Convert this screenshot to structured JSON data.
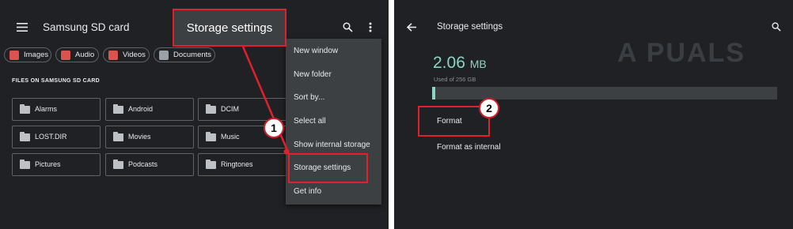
{
  "left_panel": {
    "title": "Samsung SD card",
    "filter_chips": [
      {
        "label": "Images",
        "icon": "image-icon",
        "color": "#d9534f"
      },
      {
        "label": "Audio",
        "icon": "audio-icon",
        "color": "#d9534f"
      },
      {
        "label": "Videos",
        "icon": "video-icon",
        "color": "#d9534f"
      },
      {
        "label": "Documents",
        "icon": "document-icon",
        "color": "#9aa0a6"
      }
    ],
    "section_title": "FILES ON SAMSUNG SD CARD",
    "folders": [
      {
        "label": "Alarms"
      },
      {
        "label": "Android"
      },
      {
        "label": "DCIM"
      },
      {
        "label": "LOST.DIR"
      },
      {
        "label": "Movies"
      },
      {
        "label": "Music"
      },
      {
        "label": "Pictures"
      },
      {
        "label": "Podcasts"
      },
      {
        "label": "Ringtones"
      }
    ],
    "overflow_menu": {
      "items": [
        {
          "label": "New window"
        },
        {
          "label": "New folder"
        },
        {
          "label": "Sort by..."
        },
        {
          "label": "Select all"
        },
        {
          "label": "Show internal storage"
        },
        {
          "label": "Storage settings"
        },
        {
          "label": "Get info"
        }
      ]
    },
    "callout_label": "Storage settings",
    "step_badge": "1"
  },
  "right_panel": {
    "title": "Storage settings",
    "used_value": "2.06",
    "used_unit": "MB",
    "used_caption": "Used of 256 GB",
    "used_fraction": 0.01,
    "options": [
      {
        "label": "Format"
      },
      {
        "label": "Format as internal"
      }
    ],
    "step_badge": "2",
    "watermark": "A PUALS"
  },
  "colors": {
    "background": "#202124",
    "accent": "#8bd5c5",
    "highlight": "#e0202a"
  }
}
